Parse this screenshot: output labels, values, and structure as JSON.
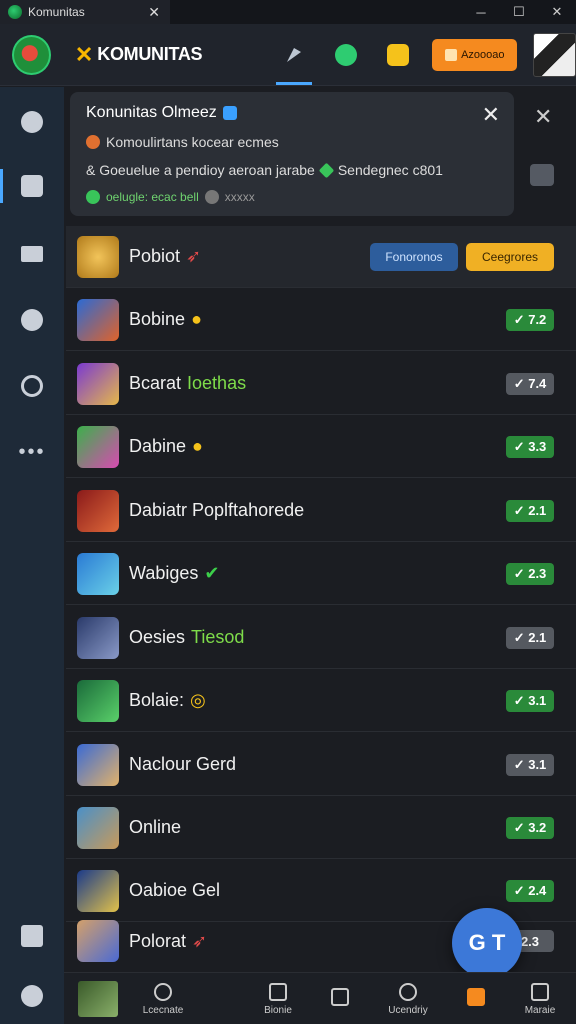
{
  "window": {
    "title": "Komunitas",
    "controls": [
      "─",
      "☐",
      "✕"
    ],
    "tab_close": "✕"
  },
  "appbar": {
    "brand": "KOMUNITAS",
    "promo_label": "Azoooao"
  },
  "notification": {
    "title": "Konunitas Olmeez",
    "line1": "Komoulirtans kocear ecmes",
    "line2": "& Goeuelue a pendioy aeroan jarabe",
    "line2_tail": "Sendegnec c801",
    "foot_green": "oelugle: ecac bell",
    "foot_grey": "xxxxx",
    "close": "✕",
    "outer_close": "✕"
  },
  "list": {
    "header_buttons": {
      "blue": "Fonoronos",
      "amber": "Ceegrores"
    },
    "rows": [
      {
        "name": "Pobiot",
        "badge": ""
      },
      {
        "name": "Bobine",
        "badge": "✓ 7.2"
      },
      {
        "name": "Bcarat",
        "accent": "Ioethas",
        "badge": "✓ 7.4"
      },
      {
        "name": "Dabine",
        "badge": "✓ 3.3"
      },
      {
        "name": "Dabiatr Poplftahorede",
        "badge": "✓ 2.1"
      },
      {
        "name": "Wabiges",
        "badge": "✓ 2.3"
      },
      {
        "name": "Oesies",
        "accent": "Tiesod",
        "badge": "✓ 2.1"
      },
      {
        "name": "Bolaie:",
        "badge": "✓ 3.1"
      },
      {
        "name": "Naclour Gerd",
        "badge": "✓ 3.1"
      },
      {
        "name": "Online",
        "badge": "✓ 3.2"
      },
      {
        "name": "Oabioe Gel",
        "badge": "✓ 2.4"
      },
      {
        "name": "Polorat",
        "badge": "2.3"
      }
    ]
  },
  "fab": {
    "label": "G T"
  },
  "bottombar": {
    "items": [
      {
        "label": "Lcecnate"
      },
      {
        "label": "Bionie"
      },
      {
        "label": ""
      },
      {
        "label": "Ucendriy"
      },
      {
        "label": ""
      },
      {
        "label": "Maraie"
      }
    ]
  },
  "colors": {
    "accent_blue": "#4aa8ff",
    "badge_green": "#2a8a3a",
    "promo_orange": "#f58a1f",
    "brand_yellow": "#f7b500"
  }
}
